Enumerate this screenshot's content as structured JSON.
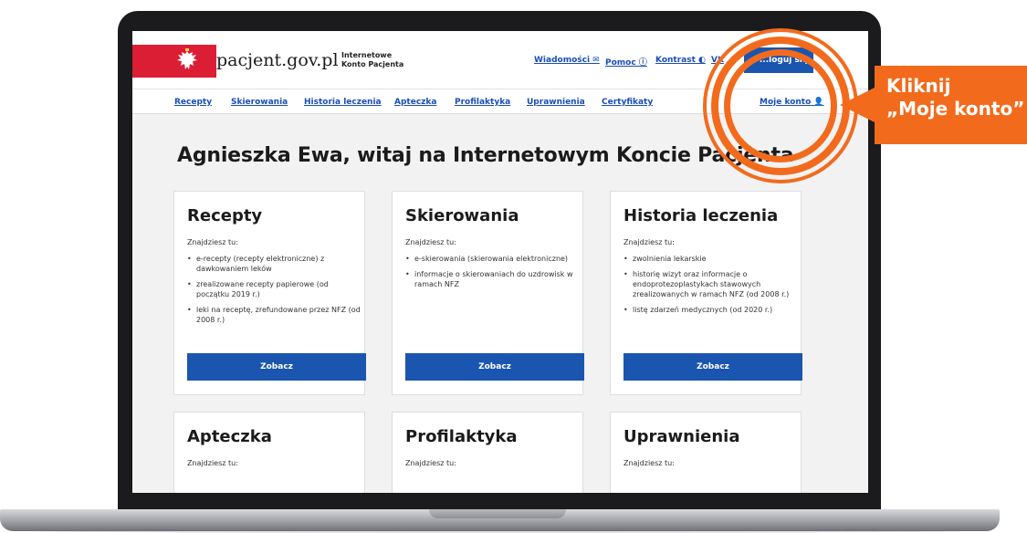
{
  "site": {
    "logo": "pacjent.gov.pl",
    "subtitle_line1": "Internetowe",
    "subtitle_line2": "Konto Pacjenta"
  },
  "top_links": {
    "messages": "Wiadomości ✉",
    "help": "Pomoc ⓘ",
    "contrast": "Kontrast ◐",
    "vk": "VK",
    "logout": "...loguj się"
  },
  "nav": [
    "Recepty",
    "Skierowania",
    "Historia leczenia",
    "Apteczka",
    "Profilaktyka",
    "Uprawnienia",
    "Certyfikaty"
  ],
  "account_link": "Moje konto",
  "heading": "Agnieszka Ewa, witaj na Internetowym Koncie Pacjenta",
  "cards": [
    {
      "title": "Recepty",
      "intro": "Znajdziesz tu:",
      "items": [
        "e-recepty (recepty elektroniczne) z dawkowaniem leków",
        "zrealizowane recepty papierowe (od początku 2019 r.)",
        "leki na receptę, zrefundowane przez NFZ (od 2008 r.)"
      ],
      "button": "Zobacz"
    },
    {
      "title": "Skierowania",
      "intro": "Znajdziesz tu:",
      "items": [
        "e-skierowania (skierowania elektroniczne)",
        "informacje o skierowaniach do uzdrowisk w ramach NFZ"
      ],
      "button": "Zobacz"
    },
    {
      "title": "Historia leczenia",
      "intro": "Znajdziesz tu:",
      "items": [
        "zwolnienia lekarskie",
        "historię wizyt oraz informacje o endoprotezoplastykach stawowych zrealizowanych w ramach NFZ (od 2008 r.)",
        "listę zdarzeń medycznych (od 2020 r.)"
      ],
      "button": "Zobacz"
    },
    {
      "title": "Apteczka",
      "intro": "Znajdziesz tu:"
    },
    {
      "title": "Profilaktyka",
      "intro": "Znajdziesz tu:"
    },
    {
      "title": "Uprawnienia",
      "intro": "Znajdziesz tu:"
    }
  ],
  "callout": {
    "line1": "Kliknij",
    "line2": "„Moje konto”"
  },
  "colors": {
    "accent_orange": "#f26b1d",
    "primary_blue": "#1a55b0",
    "flag_red": "#dc1e35"
  }
}
